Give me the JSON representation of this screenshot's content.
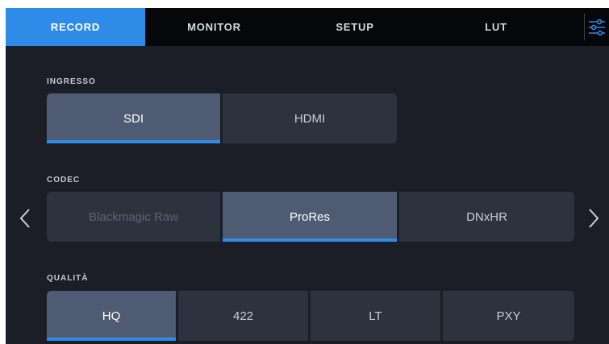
{
  "tabs": [
    {
      "label": "RECORD",
      "active": true
    },
    {
      "label": "MONITOR",
      "active": false
    },
    {
      "label": "SETUP",
      "active": false
    },
    {
      "label": "LUT",
      "active": false
    }
  ],
  "menu_icon": "sliders-icon",
  "accent_color": "#2f8be8",
  "input": {
    "label": "INGRESSO",
    "options": [
      "SDI",
      "HDMI"
    ],
    "selected": "SDI"
  },
  "codec": {
    "label": "CODEC",
    "options": [
      "Blackmagic Raw",
      "ProRes",
      "DNxHR"
    ],
    "selected": "ProRes",
    "prev_icon": "chevron-left-icon",
    "next_icon": "chevron-right-icon"
  },
  "quality": {
    "label": "QUALITÀ",
    "options": [
      "HQ",
      "422",
      "LT",
      "PXY"
    ],
    "selected": "HQ"
  }
}
